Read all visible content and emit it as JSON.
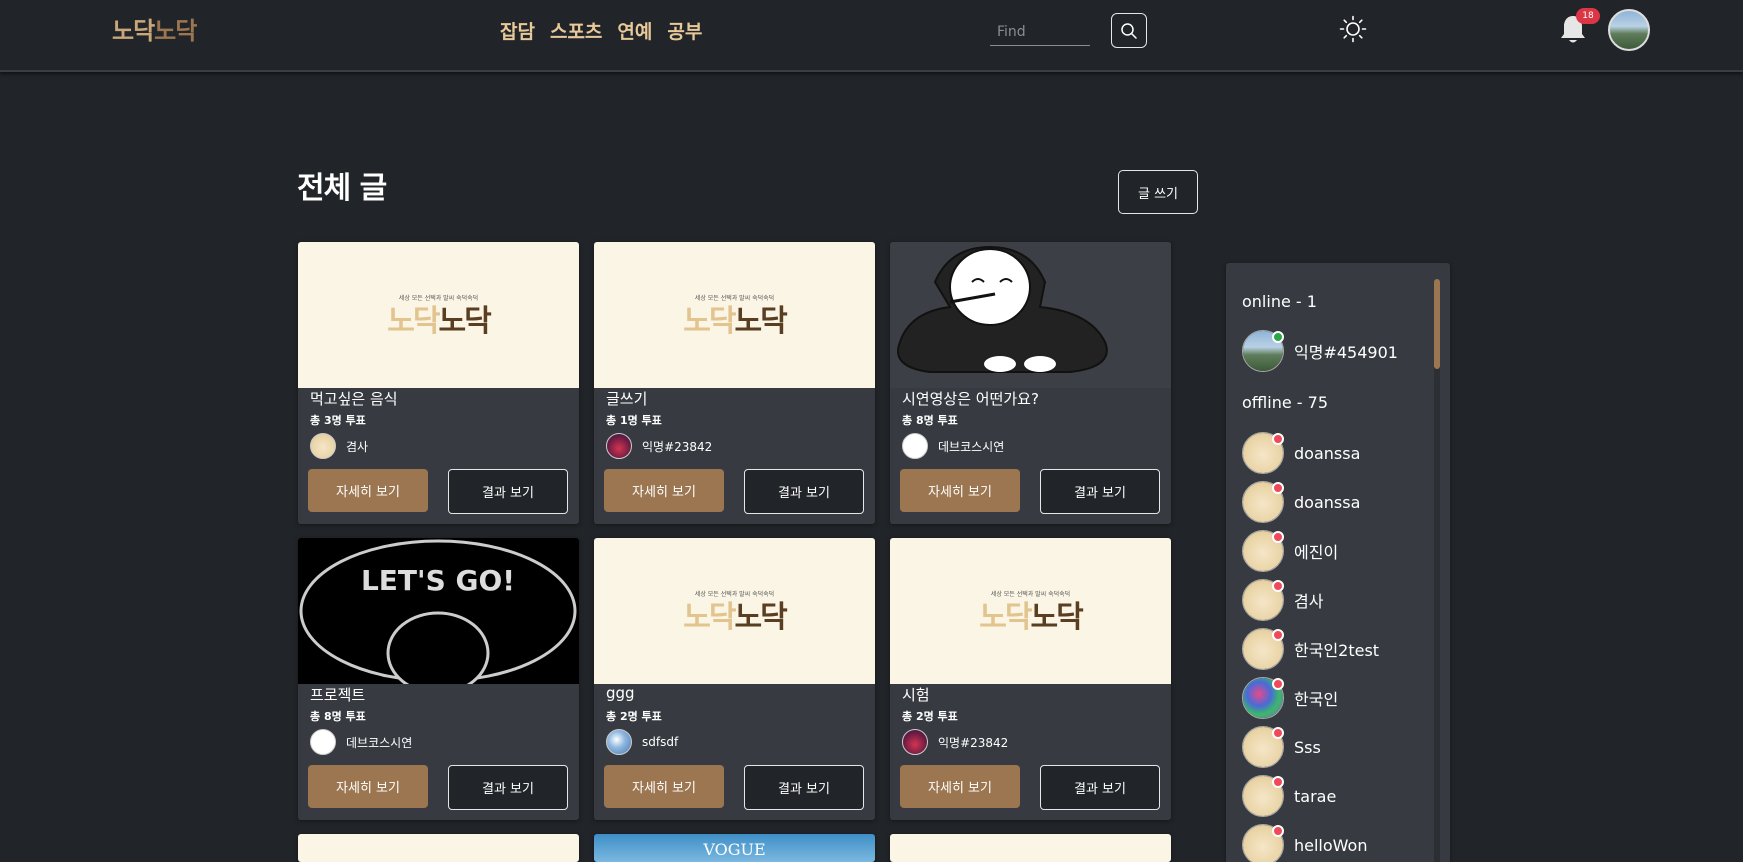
{
  "header": {
    "logo_part1": "노닥",
    "logo_part2": "노닥",
    "nav": [
      "잡담",
      "스포츠",
      "연예",
      "공부"
    ],
    "search_placeholder": "Find",
    "notification_count": "18"
  },
  "main": {
    "title": "전체 글",
    "write_label": "글 쓰기",
    "detail_label": "자세히 보기",
    "result_label": "결과 보기",
    "thumb_tagline": "세상 모든 선택과 말씨 숙덕숙덕",
    "thumb_logo_a": "노닥",
    "thumb_logo_b": "노닥",
    "letsgo_text": "LET'S GO!",
    "vogue_text": "VOGUE",
    "cards": [
      {
        "title": "먹고싶은 음식",
        "votes": "총 3명 투표",
        "author": "겸사"
      },
      {
        "title": "글쓰기",
        "votes": "총 1명 투표",
        "author": "익명#23842"
      },
      {
        "title": "시연영상은 어떤가요?",
        "votes": "총 8명 투표",
        "author": "데브코스시연"
      },
      {
        "title": "프로젝트",
        "votes": "총 8명 투표",
        "author": "데브코스시연"
      },
      {
        "title": "ggg",
        "votes": "총 2명 투표",
        "author": "sdfsdf"
      },
      {
        "title": "시험",
        "votes": "총 2명 투표",
        "author": "익명#23842"
      }
    ]
  },
  "sidebar": {
    "online_heading": "online - 1",
    "offline_heading": "offline - 75",
    "online_users": [
      "익명#454901"
    ],
    "offline_users": [
      "doanssa",
      "doanssa",
      "에진이",
      "겸사",
      "한국인2test",
      "한국인",
      "Sss",
      "tarae",
      "helloWon"
    ]
  },
  "colors": {
    "background": "#212428",
    "card": "#373b41",
    "accent": "#9b7650",
    "nav_text": "#e8c99a",
    "online": "#28a745",
    "offline": "#ef4a5a"
  },
  "icons": [
    "search-icon",
    "sun-icon",
    "bell-icon"
  ]
}
